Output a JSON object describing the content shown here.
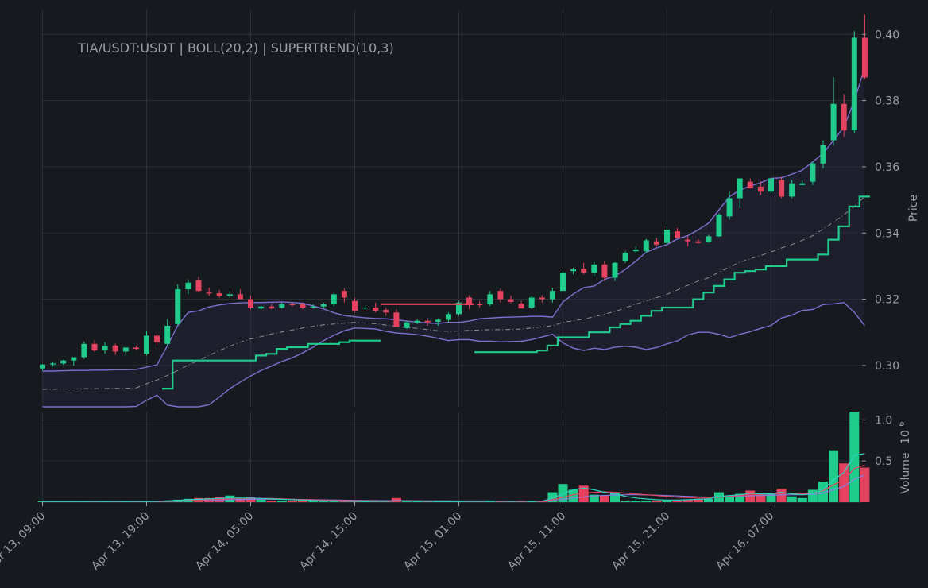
{
  "chart_data": {
    "type": "candlestick",
    "title": "TIA/USDT:USDT | BOLL(20,2) | SUPERTREND(10,3)",
    "price_ylabel": "Price",
    "volume_ylabel": "Volume",
    "volume_exponent_base": "10",
    "volume_exponent": "6",
    "price_ylim": [
      0.2875,
      0.4075
    ],
    "volume_ylim": [
      0,
      1.1
    ],
    "price_ticks": [
      {
        "v": 0.3,
        "label": "0.30"
      },
      {
        "v": 0.32,
        "label": "0.32"
      },
      {
        "v": 0.34,
        "label": "0.34"
      },
      {
        "v": 0.36,
        "label": "0.36"
      },
      {
        "v": 0.38,
        "label": "0.38"
      },
      {
        "v": 0.4,
        "label": "0.40"
      }
    ],
    "volume_ticks": [
      {
        "v": 0.5,
        "label": "0.5"
      },
      {
        "v": 1.0,
        "label": "1.0"
      }
    ],
    "x_ticks": [
      {
        "i": 0,
        "label": "Apr 13, 09:00"
      },
      {
        "i": 10,
        "label": "Apr 13, 19:00"
      },
      {
        "i": 20,
        "label": "Apr 14, 05:00"
      },
      {
        "i": 30,
        "label": "Apr 14, 15:00"
      },
      {
        "i": 40,
        "label": "Apr 15, 01:00"
      },
      {
        "i": 50,
        "label": "Apr 15, 11:00"
      },
      {
        "i": 60,
        "label": "Apr 15, 21:00"
      },
      {
        "i": 70,
        "label": "Apr 16, 07:00"
      }
    ],
    "grid": true,
    "colors": {
      "up": "#1fcc8c",
      "down": "#e5425f",
      "boll_band": "#7f6fd1",
      "boll_mid": "#8d8f96",
      "supertrend_up": "#1fcc8c",
      "supertrend_down": "#e5425f",
      "vol_ma_1": "#2fd3c4",
      "vol_ma_2": "#e5425f",
      "vol_ma_3": "#8a7de0"
    },
    "ohlc": [
      [
        0.2991,
        0.3004,
        0.2985,
        0.3003
      ],
      [
        0.3003,
        0.301,
        0.2997,
        0.3006
      ],
      [
        0.3006,
        0.3017,
        0.3002,
        0.3015
      ],
      [
        0.3015,
        0.3023,
        0.3,
        0.3025
      ],
      [
        0.3025,
        0.3072,
        0.302,
        0.3065
      ],
      [
        0.3065,
        0.3076,
        0.304,
        0.3045
      ],
      [
        0.3045,
        0.307,
        0.3035,
        0.306
      ],
      [
        0.306,
        0.3066,
        0.3032,
        0.3042
      ],
      [
        0.3042,
        0.3052,
        0.303,
        0.3054
      ],
      [
        0.3054,
        0.306,
        0.3047,
        0.305
      ],
      [
        0.3035,
        0.3105,
        0.303,
        0.309
      ],
      [
        0.309,
        0.3095,
        0.306,
        0.307
      ],
      [
        0.3065,
        0.314,
        0.306,
        0.312
      ],
      [
        0.3125,
        0.3245,
        0.312,
        0.323
      ],
      [
        0.323,
        0.326,
        0.3215,
        0.325
      ],
      [
        0.3258,
        0.3268,
        0.322,
        0.3225
      ],
      [
        0.322,
        0.3235,
        0.321,
        0.3218
      ],
      [
        0.3218,
        0.3228,
        0.3205,
        0.321
      ],
      [
        0.321,
        0.3225,
        0.3203,
        0.3215
      ],
      [
        0.3215,
        0.323,
        0.3205,
        0.32
      ],
      [
        0.32,
        0.321,
        0.317,
        0.3175
      ],
      [
        0.3172,
        0.3182,
        0.3168,
        0.3178
      ],
      [
        0.3178,
        0.3185,
        0.317,
        0.3172
      ],
      [
        0.3174,
        0.319,
        0.3172,
        0.3185
      ],
      [
        0.3185,
        0.319,
        0.3178,
        0.3182
      ],
      [
        0.3185,
        0.319,
        0.317,
        0.3175
      ],
      [
        0.3175,
        0.3185,
        0.3172,
        0.3178
      ],
      [
        0.3178,
        0.319,
        0.3172,
        0.3185
      ],
      [
        0.3185,
        0.322,
        0.318,
        0.3215
      ],
      [
        0.3225,
        0.3232,
        0.319,
        0.3205
      ],
      [
        0.3195,
        0.3205,
        0.316,
        0.3165
      ],
      [
        0.3172,
        0.318,
        0.3168,
        0.3175
      ],
      [
        0.3175,
        0.319,
        0.316,
        0.3165
      ],
      [
        0.3168,
        0.3175,
        0.315,
        0.316
      ],
      [
        0.316,
        0.317,
        0.3115,
        0.3115
      ],
      [
        0.3113,
        0.3135,
        0.311,
        0.313
      ],
      [
        0.313,
        0.314,
        0.3125,
        0.3135
      ],
      [
        0.3135,
        0.3143,
        0.312,
        0.313
      ],
      [
        0.3132,
        0.3142,
        0.312,
        0.3138
      ],
      [
        0.3138,
        0.316,
        0.313,
        0.3155
      ],
      [
        0.3155,
        0.3195,
        0.315,
        0.319
      ],
      [
        0.3205,
        0.3212,
        0.317,
        0.3182
      ],
      [
        0.3185,
        0.3195,
        0.3175,
        0.3182
      ],
      [
        0.3185,
        0.3225,
        0.318,
        0.3215
      ],
      [
        0.3225,
        0.3232,
        0.319,
        0.32
      ],
      [
        0.32,
        0.3212,
        0.3188,
        0.3192
      ],
      [
        0.3187,
        0.3195,
        0.3174,
        0.3172
      ],
      [
        0.3175,
        0.321,
        0.317,
        0.3205
      ],
      [
        0.3205,
        0.3212,
        0.319,
        0.32
      ],
      [
        0.32,
        0.3235,
        0.319,
        0.3225
      ],
      [
        0.3225,
        0.3285,
        0.3225,
        0.328
      ],
      [
        0.3285,
        0.3295,
        0.3275,
        0.329
      ],
      [
        0.3292,
        0.331,
        0.3275,
        0.328
      ],
      [
        0.328,
        0.3312,
        0.327,
        0.3305
      ],
      [
        0.3305,
        0.3315,
        0.3255,
        0.3265
      ],
      [
        0.3265,
        0.3312,
        0.3255,
        0.331
      ],
      [
        0.3315,
        0.3345,
        0.331,
        0.334
      ],
      [
        0.3345,
        0.336,
        0.3338,
        0.335
      ],
      [
        0.3345,
        0.3382,
        0.334,
        0.3378
      ],
      [
        0.3375,
        0.3385,
        0.336,
        0.3365
      ],
      [
        0.337,
        0.342,
        0.3365,
        0.341
      ],
      [
        0.3405,
        0.3415,
        0.3385,
        0.3385
      ],
      [
        0.338,
        0.339,
        0.336,
        0.3375
      ],
      [
        0.3375,
        0.3382,
        0.3368,
        0.337
      ],
      [
        0.3372,
        0.3395,
        0.337,
        0.339
      ],
      [
        0.339,
        0.346,
        0.3388,
        0.3455
      ],
      [
        0.345,
        0.3525,
        0.344,
        0.3505
      ],
      [
        0.3505,
        0.3565,
        0.3475,
        0.3565
      ],
      [
        0.3555,
        0.3565,
        0.3535,
        0.3535
      ],
      [
        0.354,
        0.3556,
        0.3515,
        0.3525
      ],
      [
        0.3525,
        0.3565,
        0.352,
        0.3565
      ],
      [
        0.356,
        0.357,
        0.3505,
        0.351
      ],
      [
        0.351,
        0.356,
        0.3505,
        0.355
      ],
      [
        0.3545,
        0.356,
        0.355,
        0.355
      ],
      [
        0.3555,
        0.3615,
        0.3545,
        0.361
      ],
      [
        0.361,
        0.368,
        0.3595,
        0.3665
      ],
      [
        0.368,
        0.387,
        0.3665,
        0.379
      ],
      [
        0.379,
        0.382,
        0.369,
        0.371
      ],
      [
        0.371,
        0.401,
        0.37,
        0.399
      ],
      [
        0.399,
        0.406,
        0.3865,
        0.387
      ]
    ],
    "volume": [
      0.01,
      0.01,
      0.01,
      0.01,
      0.01,
      0.01,
      0.01,
      0.01,
      0.01,
      0.01,
      0.01,
      0.01,
      0.02,
      0.03,
      0.04,
      0.05,
      0.05,
      0.06,
      0.08,
      0.05,
      0.06,
      0.03,
      0.02,
      0.02,
      0.02,
      0.02,
      0.01,
      0.01,
      0.03,
      0.01,
      0.01,
      0.01,
      0.01,
      0.01,
      0.05,
      0.02,
      0.01,
      0.01,
      0.01,
      0.01,
      0.01,
      0.02,
      0.01,
      0.02,
      0.01,
      0.01,
      0.02,
      0.01,
      0.01,
      0.12,
      0.22,
      0.15,
      0.2,
      0.09,
      0.08,
      0.11,
      0.01,
      0.01,
      0.02,
      0.02,
      0.02,
      0.02,
      0.03,
      0.03,
      0.04,
      0.12,
      0.07,
      0.1,
      0.14,
      0.09,
      0.1,
      0.16,
      0.07,
      0.05,
      0.15,
      0.25,
      0.63,
      0.47,
      1.1,
      0.42
    ],
    "boll_upper": [
      0.2983,
      0.2983,
      0.2984,
      0.2985,
      0.2985,
      0.2986,
      0.2986,
      0.2987,
      0.2987,
      0.2988,
      0.2995,
      0.3002,
      0.306,
      0.3121,
      0.316,
      0.3165,
      0.3177,
      0.3183,
      0.3187,
      0.3189,
      0.319,
      0.319,
      0.3191,
      0.3192,
      0.319,
      0.3188,
      0.318,
      0.3171,
      0.3159,
      0.3151,
      0.3147,
      0.3144,
      0.3142,
      0.3141,
      0.3138,
      0.3134,
      0.3131,
      0.3128,
      0.3127,
      0.313,
      0.313,
      0.3134,
      0.3141,
      0.3143,
      0.3145,
      0.3146,
      0.3147,
      0.3148,
      0.3148,
      0.3146,
      0.3192,
      0.3216,
      0.3235,
      0.324,
      0.326,
      0.327,
      0.329,
      0.3315,
      0.3342,
      0.3355,
      0.3365,
      0.3382,
      0.3392,
      0.341,
      0.343,
      0.347,
      0.351,
      0.353,
      0.3542,
      0.3552,
      0.3565,
      0.3567,
      0.3578,
      0.359,
      0.3615,
      0.364,
      0.368,
      0.372,
      0.38,
      0.39
    ],
    "boll_mid": [
      0.2928,
      0.2928,
      0.2929,
      0.2929,
      0.293,
      0.293,
      0.293,
      0.2931,
      0.2931,
      0.2932,
      0.2945,
      0.2956,
      0.297,
      0.2985,
      0.3001,
      0.3015,
      0.303,
      0.3045,
      0.3058,
      0.307,
      0.308,
      0.3087,
      0.3095,
      0.3101,
      0.3107,
      0.3113,
      0.3118,
      0.3123,
      0.3125,
      0.3128,
      0.313,
      0.3128,
      0.3126,
      0.3122,
      0.3118,
      0.3115,
      0.3112,
      0.3108,
      0.3105,
      0.3103,
      0.3104,
      0.3106,
      0.3107,
      0.3108,
      0.3108,
      0.3109,
      0.311,
      0.3113,
      0.3117,
      0.312,
      0.313,
      0.3135,
      0.314,
      0.3147,
      0.3155,
      0.3163,
      0.3174,
      0.3185,
      0.3195,
      0.3205,
      0.3215,
      0.3228,
      0.3242,
      0.3255,
      0.3265,
      0.3282,
      0.3297,
      0.3312,
      0.3322,
      0.3332,
      0.3343,
      0.3355,
      0.3365,
      0.3378,
      0.3392,
      0.3412,
      0.3433,
      0.3455,
      0.348,
      0.351
    ],
    "boll_lower": [
      0.2873,
      0.2873,
      0.2873,
      0.2873,
      0.2874,
      0.2874,
      0.2874,
      0.2875,
      0.2875,
      0.2876,
      0.2895,
      0.291,
      0.288,
      0.285,
      0.284,
      0.2865,
      0.2881,
      0.2905,
      0.293,
      0.295,
      0.2968,
      0.2985,
      0.2998,
      0.3012,
      0.3023,
      0.3038,
      0.3055,
      0.3075,
      0.3091,
      0.3105,
      0.3113,
      0.3112,
      0.311,
      0.3103,
      0.3098,
      0.3096,
      0.3093,
      0.3088,
      0.3082,
      0.3075,
      0.3078,
      0.3078,
      0.3073,
      0.3073,
      0.3071,
      0.3072,
      0.3073,
      0.3078,
      0.3086,
      0.3094,
      0.3068,
      0.3052,
      0.3045,
      0.3052,
      0.3048,
      0.3055,
      0.3058,
      0.3055,
      0.3048,
      0.3054,
      0.3065,
      0.3074,
      0.3092,
      0.31,
      0.31,
      0.3094,
      0.3084,
      0.3094,
      0.3102,
      0.3112,
      0.3121,
      0.3143,
      0.3152,
      0.3166,
      0.3169,
      0.3184,
      0.3186,
      0.319,
      0.316,
      0.312
    ],
    "supertrend": [
      null,
      null,
      null,
      null,
      null,
      null,
      null,
      null,
      null,
      null,
      null,
      null,
      0.293,
      0.3015,
      0.3015,
      0.3015,
      0.3015,
      0.3015,
      0.3015,
      0.3015,
      0.3015,
      0.303,
      0.3035,
      0.305,
      0.3055,
      0.3055,
      0.3065,
      0.3065,
      0.3065,
      0.307,
      0.3075,
      0.3075,
      0.3075,
      0.3185,
      0.3185,
      0.3185,
      0.3185,
      0.3185,
      0.3185,
      0.3185,
      0.3185,
      0.3185,
      0.304,
      0.304,
      0.304,
      0.304,
      0.304,
      0.304,
      0.3045,
      0.306,
      0.3085,
      0.3085,
      0.3085,
      0.31,
      0.31,
      0.3115,
      0.3125,
      0.3135,
      0.315,
      0.3165,
      0.3175,
      0.3175,
      0.3175,
      0.32,
      0.322,
      0.324,
      0.326,
      0.328,
      0.3285,
      0.329,
      0.33,
      0.33,
      0.332,
      0.332,
      0.332,
      0.3335,
      0.338,
      0.342,
      0.348,
      0.351
    ],
    "supertrend_dir": [
      0,
      0,
      0,
      0,
      0,
      0,
      0,
      0,
      0,
      0,
      0,
      0,
      1,
      1,
      1,
      1,
      1,
      1,
      1,
      1,
      1,
      1,
      1,
      1,
      1,
      1,
      1,
      1,
      1,
      1,
      1,
      1,
      1,
      -1,
      -1,
      -1,
      -1,
      -1,
      -1,
      -1,
      -1,
      -1,
      1,
      1,
      1,
      1,
      1,
      1,
      1,
      1,
      1,
      1,
      1,
      1,
      1,
      1,
      1,
      1,
      1,
      1,
      1,
      1,
      1,
      1,
      1,
      1,
      1,
      1,
      1,
      1,
      1,
      1,
      1,
      1,
      1,
      1,
      1,
      1,
      1,
      1
    ],
    "vol_ma_1": [
      0.01,
      0.01,
      0.01,
      0.01,
      0.01,
      0.01,
      0.01,
      0.01,
      0.01,
      0.01,
      0.01,
      0.01,
      0.015,
      0.02,
      0.03,
      0.035,
      0.04,
      0.045,
      0.05,
      0.05,
      0.05,
      0.045,
      0.04,
      0.035,
      0.03,
      0.025,
      0.02,
      0.015,
      0.015,
      0.012,
      0.01,
      0.01,
      0.01,
      0.01,
      0.015,
      0.015,
      0.012,
      0.01,
      0.01,
      0.01,
      0.01,
      0.01,
      0.01,
      0.012,
      0.012,
      0.01,
      0.012,
      0.012,
      0.012,
      0.05,
      0.1,
      0.15,
      0.17,
      0.15,
      0.12,
      0.1,
      0.07,
      0.05,
      0.04,
      0.03,
      0.025,
      0.025,
      0.03,
      0.035,
      0.04,
      0.07,
      0.08,
      0.09,
      0.11,
      0.1,
      0.1,
      0.12,
      0.1,
      0.09,
      0.1,
      0.15,
      0.27,
      0.36,
      0.57,
      0.59
    ],
    "vol_ma_2": [
      0.01,
      0.01,
      0.01,
      0.01,
      0.01,
      0.01,
      0.01,
      0.01,
      0.01,
      0.01,
      0.01,
      0.01,
      0.012,
      0.015,
      0.02,
      0.025,
      0.03,
      0.035,
      0.04,
      0.045,
      0.048,
      0.046,
      0.044,
      0.04,
      0.036,
      0.032,
      0.028,
      0.024,
      0.02,
      0.018,
      0.016,
      0.015,
      0.014,
      0.013,
      0.015,
      0.015,
      0.014,
      0.013,
      0.012,
      0.012,
      0.012,
      0.012,
      0.012,
      0.012,
      0.012,
      0.012,
      0.012,
      0.012,
      0.012,
      0.03,
      0.06,
      0.09,
      0.11,
      0.12,
      0.125,
      0.12,
      0.11,
      0.1,
      0.09,
      0.08,
      0.07,
      0.06,
      0.055,
      0.05,
      0.05,
      0.06,
      0.07,
      0.08,
      0.09,
      0.095,
      0.1,
      0.11,
      0.11,
      0.1,
      0.11,
      0.14,
      0.21,
      0.27,
      0.41,
      0.45
    ],
    "vol_ma_3": [
      0.01,
      0.01,
      0.01,
      0.01,
      0.01,
      0.01,
      0.01,
      0.01,
      0.01,
      0.01,
      0.01,
      0.01,
      0.011,
      0.012,
      0.015,
      0.018,
      0.022,
      0.026,
      0.03,
      0.033,
      0.035,
      0.036,
      0.036,
      0.035,
      0.034,
      0.032,
      0.03,
      0.028,
      0.026,
      0.024,
      0.022,
      0.02,
      0.019,
      0.018,
      0.018,
      0.018,
      0.017,
      0.016,
      0.015,
      0.015,
      0.014,
      0.014,
      0.014,
      0.014,
      0.013,
      0.013,
      0.013,
      0.013,
      0.013,
      0.02,
      0.035,
      0.05,
      0.065,
      0.075,
      0.082,
      0.087,
      0.09,
      0.09,
      0.088,
      0.085,
      0.08,
      0.075,
      0.07,
      0.065,
      0.062,
      0.064,
      0.068,
      0.072,
      0.077,
      0.08,
      0.083,
      0.088,
      0.09,
      0.09,
      0.095,
      0.11,
      0.15,
      0.19,
      0.28,
      0.33
    ]
  }
}
